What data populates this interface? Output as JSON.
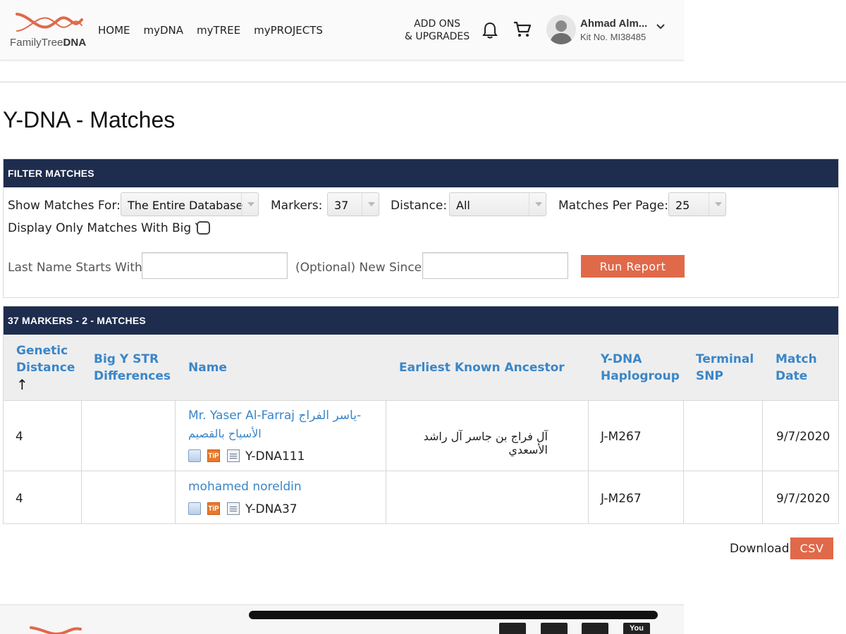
{
  "header": {
    "logo_text_regular": "FamilyTree",
    "logo_text_bold": "DNA",
    "nav": [
      "HOME",
      "myDNA",
      "myTREE",
      "myPROJECTS"
    ],
    "addons_line1": "ADD ONS",
    "addons_line2": "& UPGRADES",
    "user_name": "Ahmad Alm...",
    "kit_no": "Kit No. MI38485"
  },
  "page_title": "Y-DNA - Matches",
  "filter": {
    "heading": "FILTER MATCHES",
    "show_for_label": "Show Matches For:",
    "show_for_value": "The Entire Database",
    "markers_label": "Markers:",
    "markers_value": "37",
    "distance_label": "Distance:",
    "distance_value": "All",
    "per_page_label": "Matches Per Page:",
    "per_page_value": "25",
    "bigy_label": "Display Only Matches With Big Y:",
    "last_name_label": "Last Name Starts With:",
    "new_since_label": "(Optional) New Since:",
    "run_button": "Run Report"
  },
  "results": {
    "heading": "37 MARKERS - 2 - MATCHES",
    "columns": {
      "genetic_distance": [
        "Genetic",
        "Distance",
        "↑"
      ],
      "bigy": [
        "Big Y STR",
        "Differences"
      ],
      "name": "Name",
      "eka": "Earliest Known Ancestor",
      "haplogroup": [
        "Y-DNA",
        "Haplogroup"
      ],
      "terminal_snp": [
        "Terminal",
        "SNP"
      ],
      "match_date": [
        "Match",
        "Date"
      ]
    },
    "rows": [
      {
        "distance": "4",
        "name_line1": "Mr. Yaser Al-Farraj ياسر الفراج-",
        "name_line2": "الأسياح بالقصيم",
        "test": "Y-DNA111",
        "eka": "آل فراج بن جاسر آل راشد الأسعدي",
        "haplogroup": "J-M267",
        "date": "9/7/2020",
        "tip_label": "TiP"
      },
      {
        "distance": "4",
        "name_line1": "mohamed noreldin",
        "test": "Y-DNA37",
        "eka": "",
        "haplogroup": "J-M267",
        "date": "9/7/2020",
        "tip_label": "TiP"
      }
    ]
  },
  "download_label": "Download:",
  "csv_button": "CSV",
  "footer_social": [
    "twitter-icon",
    "facebook-icon",
    "instagram-icon",
    "youtube-icon"
  ],
  "youtube_label": "You",
  "colors": {
    "navy": "#1e2d4e",
    "accent": "#e0694a",
    "link": "#3a86c8"
  }
}
